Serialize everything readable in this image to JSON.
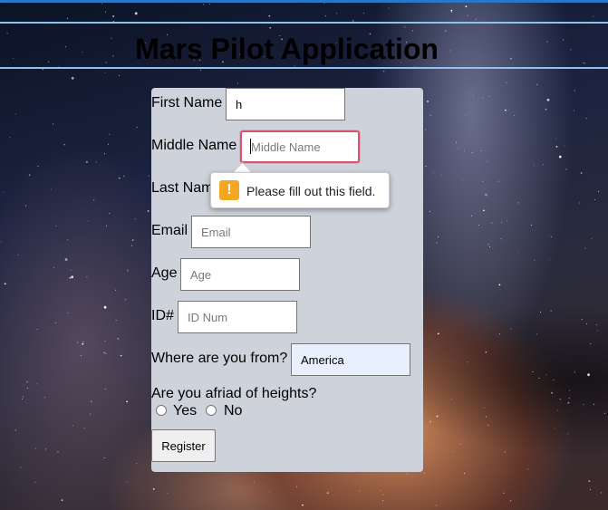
{
  "page": {
    "title": "Mars Pilot Application"
  },
  "form": {
    "first_name": {
      "label": "First Name",
      "value": "h",
      "placeholder": ""
    },
    "middle_name": {
      "label": "Middle Name",
      "value": "",
      "placeholder": "Middle Name"
    },
    "last_name": {
      "label": "Last Nam"
    },
    "email": {
      "label": "Email",
      "value": "",
      "placeholder": "Email"
    },
    "age": {
      "label": "Age",
      "value": "",
      "placeholder": "Age"
    },
    "id_num": {
      "label": "ID#",
      "value": "",
      "placeholder": "ID Num"
    },
    "origin": {
      "label": "Where are you from?",
      "value": "America"
    },
    "heights": {
      "question": "Are you afriad of heights?",
      "options": [
        "Yes",
        "No"
      ]
    },
    "register_label": "Register"
  },
  "validation": {
    "icon": "warning-icon",
    "icon_glyph": "!",
    "message": "Please fill out this field."
  },
  "colors": {
    "header_line": "#8ec0f0",
    "form_background": "#cdd2db",
    "focus_border": "#d9546b",
    "warning": "#f5a623",
    "autofill": "#e8f0fe"
  }
}
